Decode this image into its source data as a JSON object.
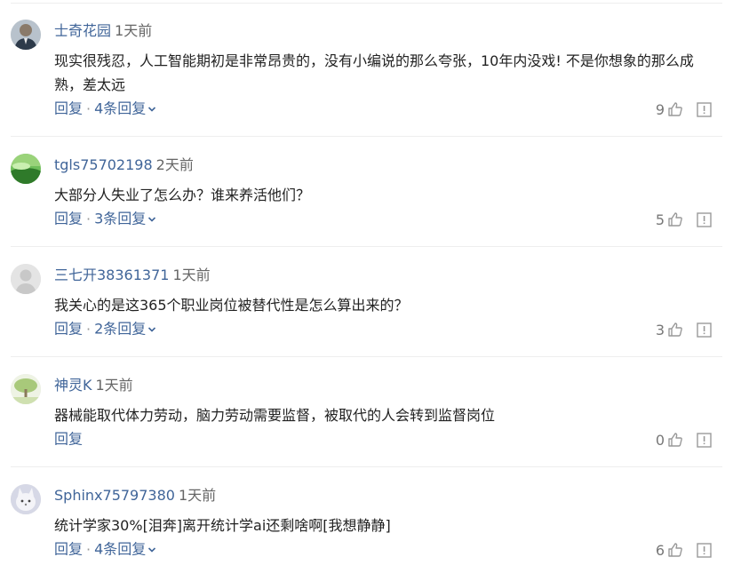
{
  "comments": [
    {
      "user": "士奇花园",
      "time": "1天前",
      "text": "现实很残忍，人工智能期初是非常昂贵的，没有小编说的那么夸张，10年内没戏! 不是你想象的那么成熟，差太远",
      "reply_label": "回复",
      "replies_label": "4条回复",
      "likes": "9"
    },
    {
      "user": "tgls75702198",
      "time": "2天前",
      "text": "大部分人失业了怎么办？谁来养活他们？",
      "reply_label": "回复",
      "replies_label": "3条回复",
      "likes": "5"
    },
    {
      "user": "三七开38361371",
      "time": "1天前",
      "text": "我关心的是这365个职业岗位被替代性是怎么算出来的？",
      "reply_label": "回复",
      "replies_label": "2条回复",
      "likes": "3"
    },
    {
      "user": "神灵K",
      "time": "1天前",
      "text": "器械能取代体力劳动，脑力劳动需要监督，被取代的人会转到监督岗位",
      "reply_label": "回复",
      "replies_label": "",
      "likes": "0"
    },
    {
      "user": "Sphinx75797380",
      "time": "1天前",
      "text": "统计学家30%[泪奔]离开统计学ai还剩啥啊[我想静静]",
      "reply_label": "回复",
      "replies_label": "4条回复",
      "likes": "6"
    }
  ],
  "separator": "·",
  "colors": {
    "link": "#406599",
    "meta": "#666666",
    "text": "#222222",
    "icon": "#999999"
  },
  "icons": {
    "like": "thumbs-up-icon",
    "report": "report-icon",
    "expand": "chevron-down-icon"
  }
}
